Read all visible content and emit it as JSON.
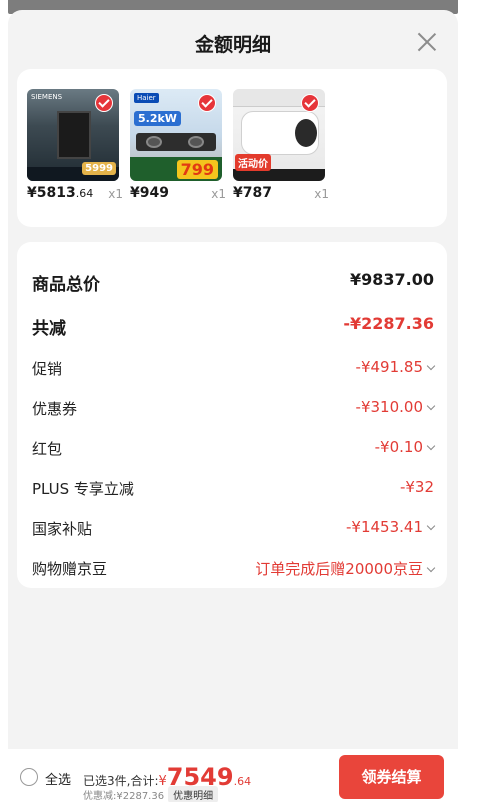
{
  "header": {
    "title": "金额明细"
  },
  "products": [
    {
      "name": "SIEMENS dishwasher",
      "price": "¥5813",
      "price_decimal": ".64",
      "qty": "x1",
      "thumb_label": "SIEMENS",
      "tag": "5999"
    },
    {
      "name": "Haier gas hob",
      "price": "¥949",
      "price_decimal": "",
      "qty": "x1",
      "thumb_label": "Haier",
      "kw": "5.2kW",
      "tag": "799"
    },
    {
      "name": "Water heater",
      "price": "¥787",
      "price_decimal": "",
      "qty": "x1",
      "tag": "活动价"
    }
  ],
  "details": {
    "total_label": "商品总价",
    "total_value": "¥9837.00",
    "reduce_label": "共减",
    "reduce_value": "-¥2287.36",
    "items": [
      {
        "label": "促销",
        "value": "-¥491.85",
        "expandable": true
      },
      {
        "label": "优惠券",
        "value": "-¥310.00",
        "expandable": true
      },
      {
        "label": "红包",
        "value": "-¥0.10",
        "expandable": true
      },
      {
        "label": "PLUS 专享立减",
        "value": "-¥32",
        "expandable": false
      },
      {
        "label": "国家补贴",
        "value": "-¥1453.41",
        "expandable": true
      },
      {
        "label": "购物赠京豆",
        "value": "订单完成后赠20000京豆",
        "expandable": true
      }
    ]
  },
  "footer": {
    "select_all": "全选",
    "summary_prefix": "已选3件,合计:",
    "currency": "¥",
    "amount_int": "7549",
    "amount_dec": ".64",
    "discount_text": "优惠减:¥2287.36",
    "detail_button": "优惠明细",
    "checkout_button": "领券结算"
  },
  "colors": {
    "accent": "#e23b35",
    "checkout_bg": "#e9453b",
    "sheet_bg": "#f3f3f3"
  }
}
